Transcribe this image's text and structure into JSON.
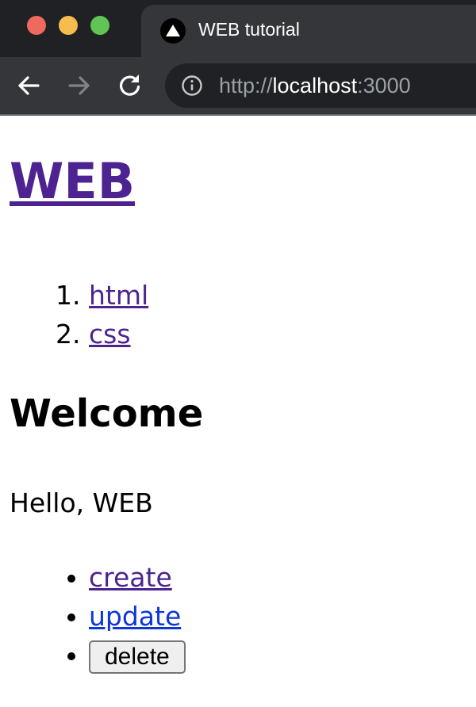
{
  "browser": {
    "tab_title": "WEB tutorial",
    "favicon": "triangle-logo-icon",
    "url_scheme": "http://",
    "url_host": "localhost",
    "url_port": ":3000",
    "colors": {
      "tabstrip": "#202124",
      "toolbar": "#35363a",
      "close": "#ee6a5f",
      "minimize": "#f5bd4f",
      "maximize": "#61c454"
    }
  },
  "page": {
    "site_title": "WEB",
    "topics": [
      {
        "label": "html"
      },
      {
        "label": "css"
      }
    ],
    "article": {
      "title": "Welcome",
      "body": "Hello, WEB"
    },
    "actions": {
      "create_label": "create",
      "update_label": "update",
      "delete_label": "delete"
    },
    "colors": {
      "visited_link": "#4c2390",
      "link": "#0d37d6"
    }
  }
}
